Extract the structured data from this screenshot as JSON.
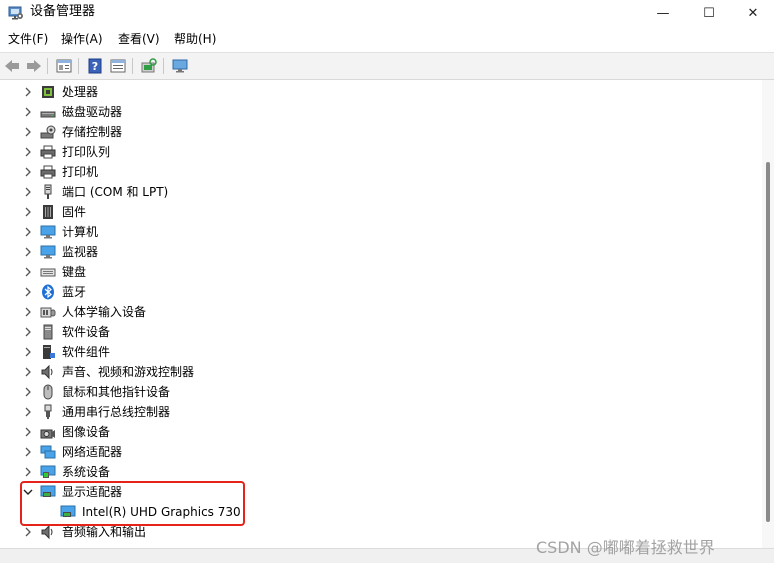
{
  "window": {
    "title": "设备管理器",
    "controls": {
      "minimize": "—",
      "maximize": "☐",
      "close": "✕"
    }
  },
  "menu": {
    "items": [
      {
        "label": "文件(F)"
      },
      {
        "label": "操作(A)"
      },
      {
        "label": "查看(V)"
      },
      {
        "label": "帮助(H)"
      }
    ]
  },
  "toolbar": {
    "buttons": [
      "back-icon",
      "forward-icon",
      "properties-icon",
      "help-icon",
      "view-icon",
      "scan-hardware-icon",
      "monitor-icon"
    ]
  },
  "tree": {
    "categories": [
      {
        "label": "处理器",
        "icon": "cpu-icon",
        "expanded": false
      },
      {
        "label": "磁盘驱动器",
        "icon": "disk-drive-icon",
        "expanded": false
      },
      {
        "label": "存储控制器",
        "icon": "storage-controller-icon",
        "expanded": false
      },
      {
        "label": "打印队列",
        "icon": "print-queue-icon",
        "expanded": false
      },
      {
        "label": "打印机",
        "icon": "printer-icon",
        "expanded": false
      },
      {
        "label": "端口 (COM 和 LPT)",
        "icon": "port-icon",
        "expanded": false
      },
      {
        "label": "固件",
        "icon": "firmware-icon",
        "expanded": false
      },
      {
        "label": "计算机",
        "icon": "computer-icon",
        "expanded": false
      },
      {
        "label": "监视器",
        "icon": "monitor-icon",
        "expanded": false
      },
      {
        "label": "键盘",
        "icon": "keyboard-icon",
        "expanded": false
      },
      {
        "label": "蓝牙",
        "icon": "bluetooth-icon",
        "expanded": false
      },
      {
        "label": "人体学输入设备",
        "icon": "hid-icon",
        "expanded": false
      },
      {
        "label": "软件设备",
        "icon": "software-device-icon",
        "expanded": false
      },
      {
        "label": "软件组件",
        "icon": "software-component-icon",
        "expanded": false
      },
      {
        "label": "声音、视频和游戏控制器",
        "icon": "sound-icon",
        "expanded": false
      },
      {
        "label": "鼠标和其他指针设备",
        "icon": "mouse-icon",
        "expanded": false
      },
      {
        "label": "通用串行总线控制器",
        "icon": "usb-icon",
        "expanded": false
      },
      {
        "label": "图像设备",
        "icon": "camera-icon",
        "expanded": false
      },
      {
        "label": "网络适配器",
        "icon": "network-adapter-icon",
        "expanded": false
      },
      {
        "label": "系统设备",
        "icon": "system-device-icon",
        "expanded": false
      },
      {
        "label": "显示适配器",
        "icon": "display-adapter-icon",
        "expanded": true
      },
      {
        "label": "Intel(R) UHD Graphics 730",
        "icon": "display-adapter-icon",
        "child": true
      },
      {
        "label": "音频输入和输出",
        "icon": "audio-io-icon",
        "expanded": false
      }
    ]
  },
  "watermark": "CSDN @嘟嘟着拯救世界",
  "colors": {
    "highlight": "#e5231b",
    "accent": "#0078d4"
  }
}
